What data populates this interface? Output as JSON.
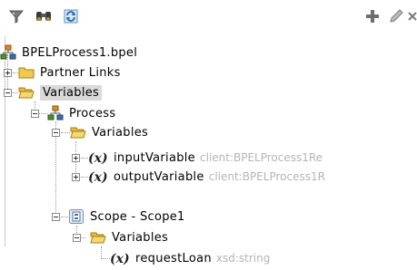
{
  "toolbar": {
    "left_icons": [
      "filter-icon",
      "binoculars-icon",
      "refresh-icon"
    ],
    "right_icons": [
      "add-icon",
      "edit-icon",
      "delete-icon"
    ]
  },
  "tree": {
    "root": "BPELProcess1.bpel",
    "partner_links": "Partner Links",
    "variables": "Variables",
    "process": "Process",
    "process_variables": "Variables",
    "input_variable": "inputVariable",
    "input_variable_type": "client:BPELProcess1Re",
    "output_variable": "outputVariable",
    "output_variable_type": "client:BPELProcess1R",
    "scope": "Scope - Scope1",
    "scope_variables": "Variables",
    "request_loan": "requestLoan",
    "request_loan_type": "xsd:string"
  },
  "var_glyph": "(x)",
  "colors": {
    "selection": "#d9d9d9",
    "type_text": "#b5b5b5",
    "folder": "#f2c94c"
  }
}
